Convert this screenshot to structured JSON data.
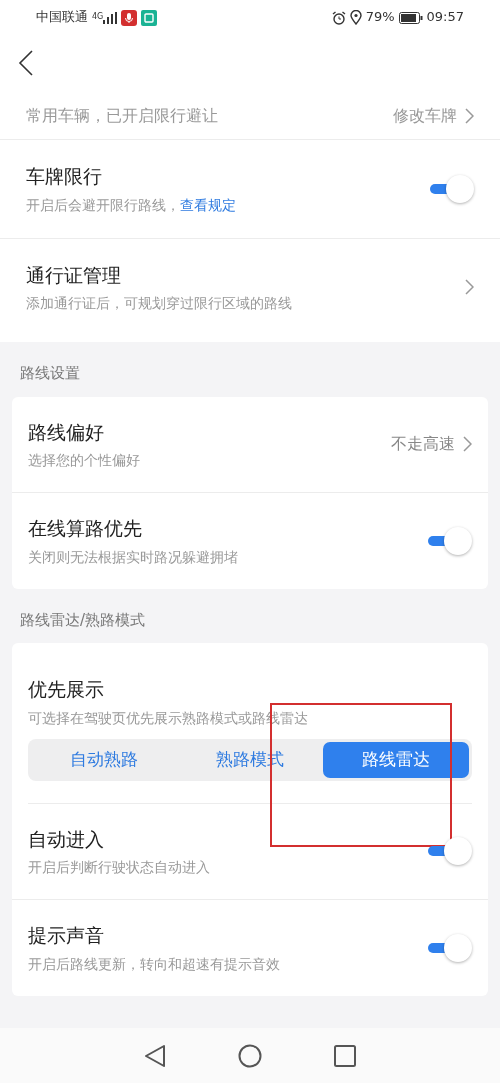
{
  "status_bar": {
    "carrier": "中国联通",
    "network": "4G",
    "battery": "79%",
    "time": "09:57"
  },
  "vehicle": {
    "text": "常用车辆，已开启限行避让",
    "action": "修改车牌"
  },
  "top_items": [
    {
      "kind": "toggle",
      "title": "车牌限行",
      "subtitle": "开启后会避开限行路线，",
      "link": "查看规定",
      "on": true
    },
    {
      "kind": "nav",
      "title": "通行证管理",
      "subtitle": "添加通行证后，可规划穿过限行区域的路线"
    }
  ],
  "sections": [
    {
      "label": "路线设置",
      "items": [
        {
          "kind": "nav",
          "title": "路线偏好",
          "subtitle": "选择您的个性偏好",
          "value": "不走高速"
        },
        {
          "kind": "toggle",
          "title": "在线算路优先",
          "subtitle": "关闭则无法根据实时路况躲避拥堵",
          "on": true
        }
      ]
    },
    {
      "label": "路线雷达/熟路模式",
      "items": [
        {
          "kind": "segment",
          "title": "优先展示",
          "subtitle": "可选择在驾驶页优先展示熟路模式或路线雷达",
          "options": [
            {
              "label": "自动熟路",
              "selected": false
            },
            {
              "label": "熟路模式",
              "selected": false
            },
            {
              "label": "路线雷达",
              "selected": true
            }
          ],
          "highlighted": true
        },
        {
          "kind": "toggle",
          "title": "自动进入",
          "subtitle": "开启后判断行驶状态自动进入",
          "on": true
        },
        {
          "kind": "toggle",
          "title": "提示声音",
          "subtitle": "开启后路线更新，转向和超速有提示音效",
          "on": true
        }
      ]
    }
  ]
}
